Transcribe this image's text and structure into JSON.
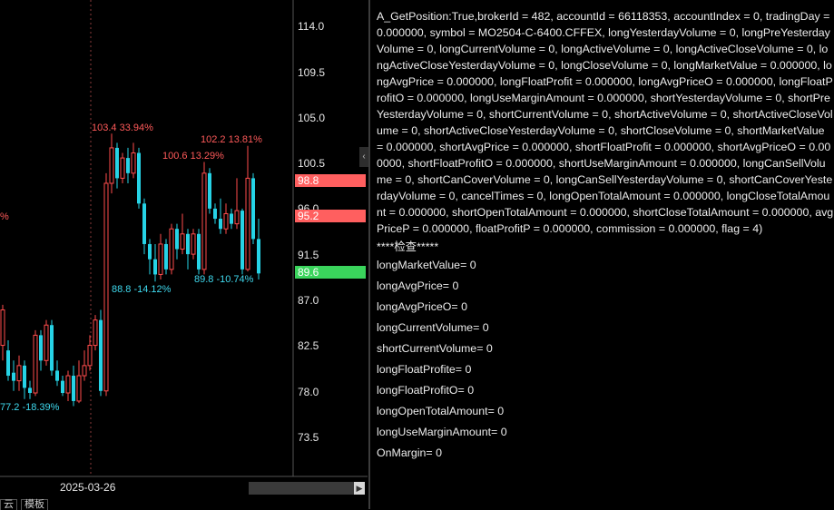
{
  "chart": {
    "y_axis_ticks": [
      "114.0",
      "109.5",
      "105.0",
      "100.5",
      "96.0",
      "91.5",
      "87.0",
      "82.5",
      "78.0",
      "73.5"
    ],
    "y_axis_range": [
      73.5,
      114.0
    ],
    "price_tags": [
      {
        "label": "98.8",
        "value": 98.8,
        "color": "#ff5f5f"
      },
      {
        "label": "95.2",
        "value": 95.2,
        "color": "#ff5f5f"
      },
      {
        "label": "89.6",
        "value": 89.6,
        "color": "#3ad45c"
      }
    ],
    "annotations": [
      {
        "text": "103.4 33.94%",
        "kind": "high"
      },
      {
        "text": "102.2 13.81%",
        "kind": "high"
      },
      {
        "text": "100.6 13.29%",
        "kind": "high"
      },
      {
        "text": "88.8 -14.12%",
        "kind": "low"
      },
      {
        "text": "89.8 -10.74%",
        "kind": "low"
      },
      {
        "text": "77.2 -18.39%",
        "kind": "low"
      },
      {
        "text": "%",
        "kind": "high"
      }
    ],
    "date_label": "2025-03-26",
    "up_color": "#ff4d4d",
    "down_color": "#26d3e6",
    "candles": [
      {
        "o": 82.5,
        "c": 86.0,
        "h": 86.5,
        "l": 81.0
      },
      {
        "o": 82.0,
        "c": 79.5,
        "h": 83.0,
        "l": 79.0
      },
      {
        "o": 79.8,
        "c": 79.0,
        "h": 81.0,
        "l": 78.0
      },
      {
        "o": 79.0,
        "c": 80.5,
        "h": 81.5,
        "l": 78.0
      },
      {
        "o": 80.5,
        "c": 78.3,
        "h": 81.0,
        "l": 77.2
      },
      {
        "o": 78.3,
        "c": 77.8,
        "h": 79.0,
        "l": 77.2
      },
      {
        "o": 77.8,
        "c": 83.5,
        "h": 84.0,
        "l": 77.5
      },
      {
        "o": 83.5,
        "c": 81.0,
        "h": 84.0,
        "l": 80.0
      },
      {
        "o": 81.0,
        "c": 84.5,
        "h": 85.0,
        "l": 80.5
      },
      {
        "o": 84.5,
        "c": 80.0,
        "h": 85.0,
        "l": 79.5
      },
      {
        "o": 80.0,
        "c": 79.0,
        "h": 81.0,
        "l": 78.5
      },
      {
        "o": 79.0,
        "c": 77.8,
        "h": 79.5,
        "l": 77.5
      },
      {
        "o": 77.8,
        "c": 79.5,
        "h": 80.0,
        "l": 77.0
      },
      {
        "o": 79.5,
        "c": 77.0,
        "h": 80.5,
        "l": 76.5
      },
      {
        "o": 77.0,
        "c": 79.5,
        "h": 81.0,
        "l": 76.8
      },
      {
        "o": 79.5,
        "c": 80.5,
        "h": 82.0,
        "l": 79.0
      },
      {
        "o": 80.5,
        "c": 82.5,
        "h": 83.5,
        "l": 80.0
      },
      {
        "o": 82.5,
        "c": 85.0,
        "h": 85.5,
        "l": 82.0
      },
      {
        "o": 85.0,
        "c": 78.0,
        "h": 86.0,
        "l": 77.5
      },
      {
        "o": 78.0,
        "c": 98.5,
        "h": 99.5,
        "l": 77.5
      },
      {
        "o": 98.5,
        "c": 102.0,
        "h": 103.4,
        "l": 97.5
      },
      {
        "o": 102.0,
        "c": 99.0,
        "h": 102.5,
        "l": 98.0
      },
      {
        "o": 99.0,
        "c": 101.0,
        "h": 101.5,
        "l": 98.5
      },
      {
        "o": 101.0,
        "c": 99.5,
        "h": 102.0,
        "l": 98.5
      },
      {
        "o": 99.5,
        "c": 101.5,
        "h": 102.5,
        "l": 99.0
      },
      {
        "o": 101.5,
        "c": 96.5,
        "h": 102.0,
        "l": 96.0
      },
      {
        "o": 96.5,
        "c": 92.5,
        "h": 97.0,
        "l": 91.5
      },
      {
        "o": 92.5,
        "c": 91.0,
        "h": 93.0,
        "l": 89.5
      },
      {
        "o": 91.0,
        "c": 89.5,
        "h": 92.5,
        "l": 88.8
      },
      {
        "o": 89.5,
        "c": 92.5,
        "h": 93.5,
        "l": 89.0
      },
      {
        "o": 92.5,
        "c": 90.0,
        "h": 93.0,
        "l": 89.5
      },
      {
        "o": 90.0,
        "c": 94.0,
        "h": 94.5,
        "l": 89.5
      },
      {
        "o": 94.0,
        "c": 92.0,
        "h": 94.5,
        "l": 91.0
      },
      {
        "o": 92.0,
        "c": 93.5,
        "h": 95.5,
        "l": 91.5
      },
      {
        "o": 93.5,
        "c": 91.5,
        "h": 94.0,
        "l": 90.0
      },
      {
        "o": 91.5,
        "c": 93.5,
        "h": 94.0,
        "l": 91.0
      },
      {
        "o": 93.5,
        "c": 90.0,
        "h": 94.0,
        "l": 89.5
      },
      {
        "o": 90.0,
        "c": 99.5,
        "h": 100.6,
        "l": 89.5
      },
      {
        "o": 99.5,
        "c": 96.0,
        "h": 100.0,
        "l": 95.5
      },
      {
        "o": 96.0,
        "c": 95.0,
        "h": 96.5,
        "l": 94.5
      },
      {
        "o": 95.0,
        "c": 94.0,
        "h": 97.0,
        "l": 93.5
      },
      {
        "o": 94.0,
        "c": 95.5,
        "h": 96.5,
        "l": 93.5
      },
      {
        "o": 95.5,
        "c": 94.5,
        "h": 96.0,
        "l": 94.0
      },
      {
        "o": 94.5,
        "c": 95.8,
        "h": 99.0,
        "l": 94.0
      },
      {
        "o": 95.8,
        "c": 90.0,
        "h": 96.0,
        "l": 89.5
      },
      {
        "o": 90.0,
        "c": 99.0,
        "h": 102.2,
        "l": 89.8
      },
      {
        "o": 99.0,
        "c": 93.0,
        "h": 99.5,
        "l": 92.5
      },
      {
        "o": 93.0,
        "c": 89.6,
        "h": 95.0,
        "l": 89.0
      }
    ]
  },
  "bottom_tabs": [
    "云",
    "模板"
  ],
  "log": {
    "position_text": "A_GetPosition:True,brokerId = 482, accountId = 66118353, accountIndex = 0, tradingDay = 0.000000, symbol = MO2504-C-6400.CFFEX, longYesterdayVolume = 0, longPreYesterdayVolume = 0, longCurrentVolume = 0, longActiveVolume = 0, longActiveCloseVolume = 0, longActiveCloseYesterdayVolume = 0, longCloseVolume = 0, longMarketValue = 0.000000, longAvgPrice = 0.000000, longFloatProfit = 0.000000, longAvgPriceO = 0.000000, longFloatProfitO = 0.000000, longUseMarginAmount = 0.000000, shortYesterdayVolume = 0, shortPreYesterdayVolume = 0, shortCurrentVolume = 0, shortActiveVolume = 0, shortActiveCloseVolume = 0, shortActiveCloseYesterdayVolume = 0, shortCloseVolume = 0, shortMarketValue = 0.000000, shortAvgPrice = 0.000000, shortFloatProfit = 0.000000, shortAvgPriceO = 0.000000, shortFloatProfitO = 0.000000, shortUseMarginAmount = 0.000000, longCanSellVolume = 0, shortCanCoverVolume = 0, longCanSellYesterdayVolume = 0, shortCanCoverYesterdayVolume = 0, cancelTimes = 0, longOpenTotalAmount = 0.000000, longCloseTotalAmount = 0.000000, shortOpenTotalAmount = 0.000000, shortCloseTotalAmount = 0.000000, avgPriceP = 0.000000, floatProfitP = 0.000000, commission = 0.000000, flag = 4)",
    "check_title": "****检查*****",
    "lines": [
      "longMarketValue= 0",
      "longAvgPrice= 0",
      "longAvgPriceO= 0",
      "longCurrentVolume= 0",
      "shortCurrentVolume= 0",
      "longFloatProfite= 0",
      "longFloatProfitO= 0",
      "longOpenTotalAmount= 0",
      "longUseMarginAmount= 0",
      "OnMargin= 0"
    ]
  }
}
